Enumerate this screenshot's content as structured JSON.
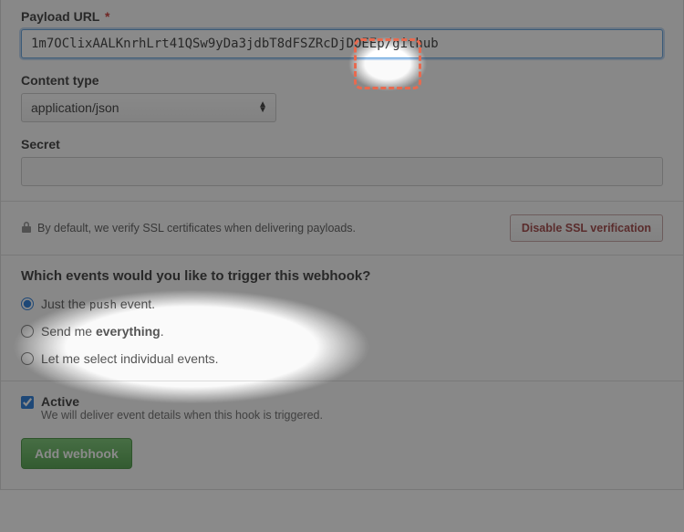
{
  "payload": {
    "label": "Payload URL",
    "value": "1m7OClixAALKnrhLrt41QSw9yDa3jdbT8dFSZRcDjDOEEp/github"
  },
  "content_type": {
    "label": "Content type",
    "selected": "application/json"
  },
  "secret": {
    "label": "Secret",
    "value": ""
  },
  "ssl": {
    "note": "By default, we verify SSL certificates when delivering payloads.",
    "disable_btn": "Disable SSL verification"
  },
  "events": {
    "heading": "Which events would you like to trigger this webhook?",
    "push_prefix": "Just the ",
    "push_code": "push",
    "push_suffix": " event.",
    "everything_prefix": "Send me ",
    "everything_bold": "everything",
    "everything_suffix": ".",
    "individual": "Let me select individual events."
  },
  "active": {
    "title": "Active",
    "sub": "We will deliver event details when this hook is triggered."
  },
  "submit": "Add webhook"
}
